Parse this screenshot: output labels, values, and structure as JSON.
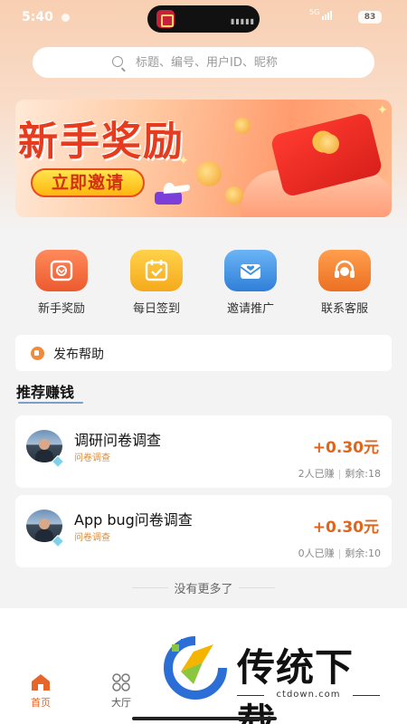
{
  "status_bar": {
    "time": "5:40",
    "battery": "83",
    "network": "5G"
  },
  "search": {
    "placeholder": "标题、编号、用户ID、昵称"
  },
  "banner": {
    "title": "新手奖励",
    "button_label": "立即邀请"
  },
  "quick_menu": [
    {
      "label": "新手奖励",
      "icon": "gift-icon",
      "color": "#f0653a"
    },
    {
      "label": "每日签到",
      "icon": "calendar-check-icon",
      "color": "#f8b92a"
    },
    {
      "label": "邀请推广",
      "icon": "envelope-heart-icon",
      "color": "#3d8fe0"
    },
    {
      "label": "联系客服",
      "icon": "headset-icon",
      "color": "#f0822e"
    }
  ],
  "help_bar": {
    "label": "发布帮助"
  },
  "section": {
    "title": "推荐赚钱"
  },
  "tasks": [
    {
      "title": "调研问卷调查",
      "tag": "问卷调查",
      "reward": "+0.30元",
      "earned": "2人已赚",
      "remaining": "剩余:18"
    },
    {
      "title": "App bug问卷调查",
      "tag": "问卷调查",
      "reward": "+0.30元",
      "earned": "0人已赚",
      "remaining": "剩余:10"
    }
  ],
  "no_more": "没有更多了",
  "bottom_nav": [
    {
      "label": "首页",
      "active": true
    },
    {
      "label": "大厅",
      "active": false
    }
  ],
  "watermark": {
    "text": "传统下载",
    "url": "ctdown.com"
  },
  "colors": {
    "accent": "#e8652a",
    "reward": "#e0651a",
    "header_bg": "#f8cfb2"
  }
}
